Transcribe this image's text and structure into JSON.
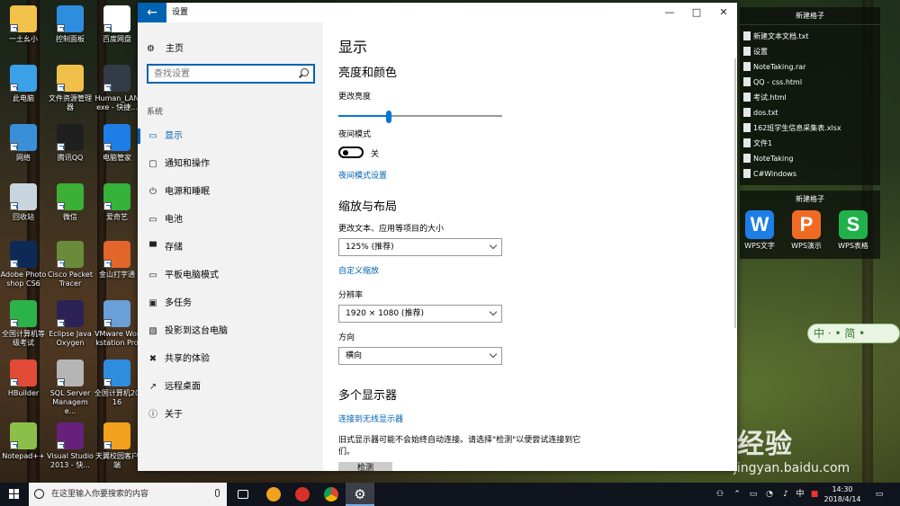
{
  "desktop": {
    "icons": [
      {
        "label": "一土幺小",
        "color": "#f3c24a"
      },
      {
        "label": "控制面板",
        "color": "#2f8de0"
      },
      {
        "label": "百度网盘",
        "color": "#ffffff"
      },
      {
        "label": "此电脑",
        "color": "#3aa0e8"
      },
      {
        "label": "文件资源管理器",
        "color": "#f0c04a"
      },
      {
        "label": "Human_LANexe - 快捷...",
        "color": "#333b46"
      },
      {
        "label": "网络",
        "color": "#3a8fd8"
      },
      {
        "label": "腾讯QQ",
        "color": "#1f1f1f"
      },
      {
        "label": "电脑管家",
        "color": "#1e7ee8"
      },
      {
        "label": "回收站",
        "color": "#c9d5de"
      },
      {
        "label": "微信",
        "color": "#3cb034"
      },
      {
        "label": "爱奇艺",
        "color": "#34b23a"
      },
      {
        "label": "Adobe Photoshop CS6",
        "color": "#0c2a55"
      },
      {
        "label": "Cisco Packet Tracer",
        "color": "#6a8c3a"
      },
      {
        "label": "金山打字通",
        "color": "#e2662a"
      },
      {
        "label": "全国计算机等级考试",
        "color": "#2bb34a"
      },
      {
        "label": "Eclipse Java Oxygen",
        "color": "#2c2255"
      },
      {
        "label": "VMware Workstation Pro",
        "color": "#6a9fd8"
      },
      {
        "label": "HBuilder",
        "color": "#e04a36"
      },
      {
        "label": "SQL Server Manageme...",
        "color": "#b5b5b5"
      },
      {
        "label": "全国计算机2016",
        "color": "#2f8de0"
      },
      {
        "label": "Notepad++",
        "color": "#8ac04a"
      },
      {
        "label": "Visual Studio 2013 - 快...",
        "color": "#68217a"
      },
      {
        "label": "天翼校园客户端",
        "color": "#f2a11f"
      }
    ],
    "fence1": {
      "title": "新建格子",
      "items": [
        "新建文本文档.txt",
        "设置",
        "NoteTaking.rar",
        "QQ - css.html",
        "考试.html",
        "dos.txt",
        "162班学生信息采集表.xlsx",
        "文件1",
        "NoteTaking",
        "C#Windows"
      ]
    },
    "fence2": {
      "title": "新建格子",
      "apps": [
        {
          "glyph": "W",
          "label": "WPS文字",
          "color": "#1e7ee8"
        },
        {
          "glyph": "P",
          "label": "WPS演示",
          "color": "#f06a24"
        },
        {
          "glyph": "S",
          "label": "WPS表格",
          "color": "#20b24a"
        }
      ]
    },
    "ime": "中 · • 简 •",
    "watermark": "Bai 经验",
    "watermark_url": "jingyan.baidu.com"
  },
  "window": {
    "title": "设置",
    "back_glyph": "←",
    "min_glyph": "—",
    "max_glyph": "□",
    "close_glyph": "✕"
  },
  "nav": {
    "home": "主页",
    "search_placeholder": "查找设置",
    "section": "系统",
    "items": [
      {
        "label": "显示",
        "icon": "monitor-icon",
        "glyph": "▭"
      },
      {
        "label": "通知和操作",
        "icon": "notification-icon",
        "glyph": "▢"
      },
      {
        "label": "电源和睡眠",
        "icon": "power-icon",
        "glyph": "⏻"
      },
      {
        "label": "电池",
        "icon": "battery-icon",
        "glyph": "▭"
      },
      {
        "label": "存储",
        "icon": "storage-icon",
        "glyph": "▀"
      },
      {
        "label": "平板电脑模式",
        "icon": "tablet-icon",
        "glyph": "▭"
      },
      {
        "label": "多任务",
        "icon": "multitask-icon",
        "glyph": "▣"
      },
      {
        "label": "投影到这台电脑",
        "icon": "project-icon",
        "glyph": "▧"
      },
      {
        "label": "共享的体验",
        "icon": "share-icon",
        "glyph": "✖"
      },
      {
        "label": "远程桌面",
        "icon": "remote-icon",
        "glyph": "↗"
      },
      {
        "label": "关于",
        "icon": "info-icon",
        "glyph": "ⓘ"
      }
    ]
  },
  "content": {
    "title": "显示",
    "brightness_heading": "亮度和颜色",
    "brightness_label": "更改亮度",
    "brightness_level": 0.31,
    "night_label": "夜间模式",
    "night_state": "关",
    "night_link": "夜间模式设置",
    "scale_heading": "缩放与布局",
    "scale_label": "更改文本、应用等项目的大小",
    "scale_value": "125% (推荐)",
    "custom_scale_link": "自定义缩放",
    "resolution_label": "分辨率",
    "resolution_value": "1920 × 1080 (推荐)",
    "orientation_label": "方向",
    "orientation_value": "横向",
    "multi_heading": "多个显示器",
    "wireless_link": "连接到无线显示器",
    "note": "旧式显示器可能不会始终自动连接。请选择\"检测\"以便尝试连接到它们。",
    "detect_button": "检测"
  },
  "taskbar": {
    "search_placeholder": "在这里输入你要搜索的内容",
    "time": "14:30",
    "date": "2018/4/14",
    "tray_ime": "中",
    "colors": {
      "bg": "#10141c",
      "accent": "#0063b1"
    }
  }
}
